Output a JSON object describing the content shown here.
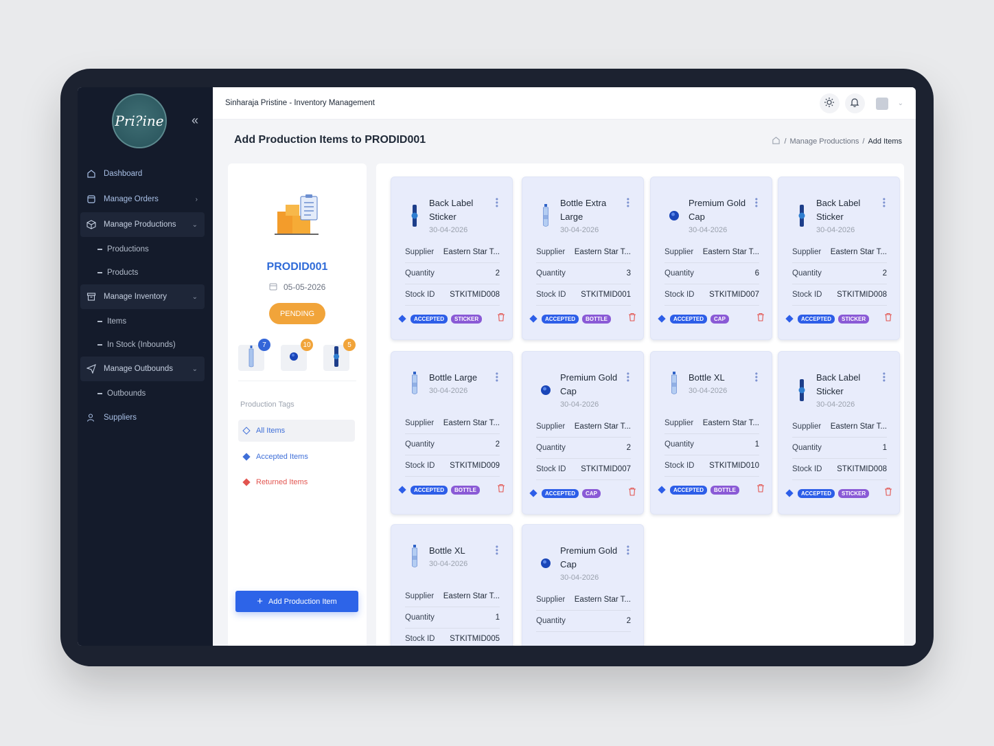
{
  "app": {
    "title": "Sinharaja Pristine - Inventory Management",
    "logo_text": "Pri?ine"
  },
  "sidebar": {
    "items": [
      {
        "label": "Dashboard",
        "icon": "home-icon"
      },
      {
        "label": "Manage Orders",
        "icon": "clipboard-icon"
      },
      {
        "label": "Manage Productions",
        "icon": "box-icon"
      },
      {
        "label": "Productions"
      },
      {
        "label": "Products"
      },
      {
        "label": "Manage Inventory",
        "icon": "archive-icon"
      },
      {
        "label": "Items"
      },
      {
        "label": "In Stock (Inbounds)"
      },
      {
        "label": "Manage Outbounds",
        "icon": "send-icon"
      },
      {
        "label": "Outbounds"
      },
      {
        "label": "Suppliers",
        "icon": "users-icon"
      }
    ]
  },
  "page": {
    "title": "Add Production Items to PRODID001",
    "breadcrumb": [
      "Manage Productions",
      "Add Items"
    ]
  },
  "production": {
    "id": "PRODID001",
    "date": "05-05-2026",
    "status": "PENDING",
    "counts": [
      "7",
      "10",
      "5"
    ],
    "tags_title": "Production Tags",
    "tags": [
      "All Items",
      "Accepted Items",
      "Returned Items"
    ],
    "add_button": "Add Production Item"
  },
  "labels": {
    "supplier": "Supplier",
    "quantity": "Quantity",
    "stock_id": "Stock ID",
    "accepted": "ACCEPTED"
  },
  "cards": [
    {
      "title": "Back Label Sticker",
      "date": "30-04-2026",
      "supplier": "Eastern Star T...",
      "quantity": "2",
      "stock_id": "STKITMID008",
      "tag": "STICKER",
      "type": "sticker"
    },
    {
      "title": "Bottle Extra Large",
      "date": "30-04-2026",
      "supplier": "Eastern Star T...",
      "quantity": "3",
      "stock_id": "STKITMID001",
      "tag": "BOTTLE",
      "type": "bottle"
    },
    {
      "title": "Premium Gold Cap",
      "date": "30-04-2026",
      "supplier": "Eastern Star T...",
      "quantity": "6",
      "stock_id": "STKITMID007",
      "tag": "CAP",
      "type": "cap"
    },
    {
      "title": "Back Label Sticker",
      "date": "30-04-2026",
      "supplier": "Eastern Star T...",
      "quantity": "2",
      "stock_id": "STKITMID008",
      "tag": "STICKER",
      "type": "sticker"
    },
    {
      "title": "Bottle Large",
      "date": "30-04-2026",
      "supplier": "Eastern Star T...",
      "quantity": "2",
      "stock_id": "STKITMID009",
      "tag": "BOTTLE",
      "type": "bottle"
    },
    {
      "title": "Premium Gold Cap",
      "date": "30-04-2026",
      "supplier": "Eastern Star T...",
      "quantity": "2",
      "stock_id": "STKITMID007",
      "tag": "CAP",
      "type": "cap"
    },
    {
      "title": "Bottle XL",
      "date": "30-04-2026",
      "supplier": "Eastern Star T...",
      "quantity": "1",
      "stock_id": "STKITMID010",
      "tag": "BOTTLE",
      "type": "bottle"
    },
    {
      "title": "Back Label Sticker",
      "date": "30-04-2026",
      "supplier": "Eastern Star T...",
      "quantity": "1",
      "stock_id": "STKITMID008",
      "tag": "STICKER",
      "type": "sticker"
    },
    {
      "title": "Bottle XL",
      "date": "30-04-2026",
      "supplier": "Eastern Star T...",
      "quantity": "1",
      "stock_id": "STKITMID005",
      "tag": "",
      "type": "bottle"
    },
    {
      "title": "Premium Gold Cap",
      "date": "30-04-2026",
      "supplier": "Eastern Star T...",
      "quantity": "2",
      "stock_id": "",
      "tag": "",
      "type": "cap"
    }
  ],
  "colors": {
    "accent": "#2d64e8",
    "pending": "#f1a43a",
    "returned": "#e2544f",
    "tag_purple": "#8a5ad6"
  }
}
